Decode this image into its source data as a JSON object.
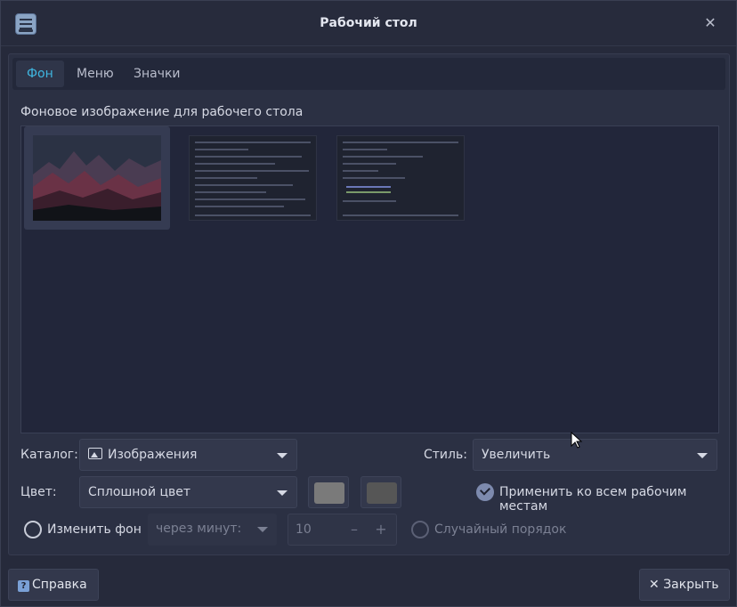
{
  "window": {
    "title": "Рабочий стол"
  },
  "tabs": [
    {
      "label": "Фон",
      "active": true
    },
    {
      "label": "Меню",
      "active": false
    },
    {
      "label": "Значки",
      "active": false
    }
  ],
  "background": {
    "section_label": "Фоновое изображение для рабочего стола",
    "thumbnails": [
      {
        "kind": "mountain-photo",
        "selected": true
      },
      {
        "kind": "screenshot",
        "selected": false
      },
      {
        "kind": "screenshot",
        "selected": false
      }
    ]
  },
  "form": {
    "catalog_label": "Каталог:",
    "catalog_value": "Изображения",
    "style_label": "Стиль:",
    "style_value": "Увеличить",
    "color_label": "Цвет:",
    "color_value": "Сплошной цвет",
    "color1": "#7a7a7a",
    "color2": "#565656",
    "apply_all_label": "Применить ко всем рабочим местам",
    "apply_all_checked": true,
    "change_bg_label": "Изменить фон",
    "change_bg_checked": false,
    "interval_value": "через минут:",
    "interval_number": "10",
    "random_order_label": "Случайный порядок",
    "random_order_checked": false
  },
  "footer": {
    "help_label": "Справка",
    "help_icon_glyph": "?",
    "close_label": "Закрыть",
    "close_glyph": "✕"
  },
  "colors": {
    "accent": "#3fb6e0",
    "background": "#262a3b"
  }
}
